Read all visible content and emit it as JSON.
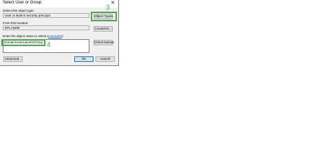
{
  "dialog": {
    "title": "Select User or Group",
    "close_glyph": "✕",
    "object_type_label": "Select this object type:",
    "object_type_value": "User or Built-in security principal",
    "object_types_button": "Object Types...",
    "location_label": "From this location:",
    "location_value": "EPLANDB",
    "locations_button": "Locations...",
    "names_label_prefix": "Enter the object name to select (",
    "names_label_link": "examples",
    "names_label_suffix": "):",
    "names_value": "Domain\\UsernameOrGroup",
    "check_names_button": "Check Names",
    "advanced_button": "Advanced...",
    "ok_button": "OK",
    "cancel_button": "Cancel"
  },
  "annotations": {
    "step3": "3",
    "step4": "4",
    "highlight_color": "#3cb043"
  }
}
